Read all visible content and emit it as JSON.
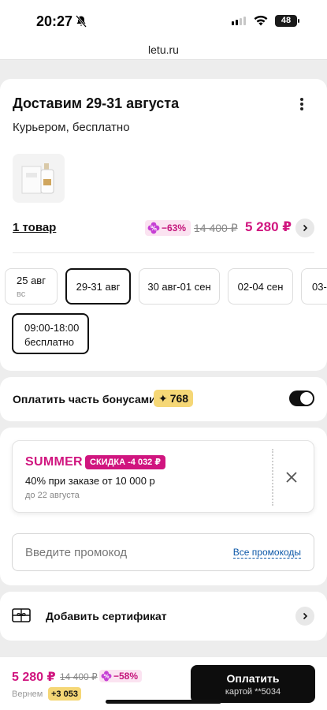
{
  "status": {
    "time": "20:27",
    "battery": "48"
  },
  "browser": {
    "url": "letu.ru"
  },
  "delivery": {
    "title": "Доставим 29-31 августа",
    "subtitle": "Курьером, бесплатно",
    "items_link": "1 товар",
    "discount": "−63%",
    "old_price": "14 400 ₽",
    "new_price": "5 280 ₽",
    "dates": [
      {
        "label": "25 авг",
        "sub": "вс"
      },
      {
        "label": "29-31 авг"
      },
      {
        "label": "30 авг-01 сен"
      },
      {
        "label": "02-04 сен"
      },
      {
        "label": "03-"
      }
    ],
    "time_slot": {
      "label": "09:00-18:00",
      "sub": "бесплатно"
    }
  },
  "bonus": {
    "label": "Оплатить часть бонусами",
    "amount": "768",
    "enabled": true
  },
  "promo": {
    "code": "SUMMER",
    "badge": "СКИДКА -4 032 ₽",
    "description": "40% при заказе от 10 000 р",
    "until": "до 22 августа",
    "input_placeholder": "Введите промокод",
    "all_codes": "Все промокоды"
  },
  "certificate": {
    "label": "Добавить сертификат"
  },
  "footer": {
    "price": "5 280 ₽",
    "old_price": "14 400 ₽",
    "discount": "−58%",
    "return_label": "Вернем",
    "return_bonus": "+3 053",
    "pay_label": "Оплатить",
    "pay_card": "картой **5034"
  },
  "colors": {
    "accent": "#d0157f",
    "bonus": "#f5d776",
    "primary_button": "#0d0d0d"
  }
}
